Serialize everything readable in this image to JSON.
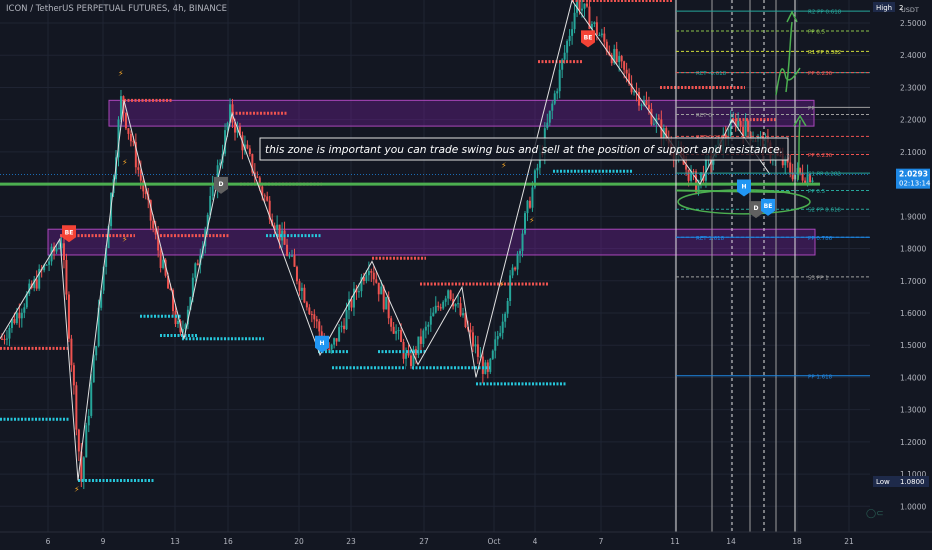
{
  "header": {
    "symbol_title": "ICON / TetherUS PERPETUAL FUTURES, 4h, BINANCE",
    "currency": "USDT"
  },
  "colors": {
    "background": "#131722",
    "grid": "#1f2433",
    "up_candle": "#26a69a",
    "down_candle": "#ef5350",
    "support_dots": "#26c6da",
    "resistance_dots": "#ef5350",
    "zone_fill": "#7b1fa2",
    "key_level": "#4caf50",
    "zigzag": "#e0e0e0",
    "price_tag": "#1e88e5",
    "annotation": "#ffffff"
  },
  "price_axis": {
    "ticks": [
      "2.5000",
      "2.4000",
      "2.3000",
      "2.2000",
      "2.1000",
      "2.0000",
      "1.9000",
      "1.8000",
      "1.7000",
      "1.6000",
      "1.5000",
      "1.4000",
      "1.3000",
      "1.2000",
      "1.1000",
      "1.0000"
    ],
    "current_price": "2.0293",
    "countdown": "02:13:14",
    "high_label": "High",
    "high_value": "2",
    "low_label": "Low",
    "low_value": "1.0800"
  },
  "time_axis": {
    "labels": [
      "6",
      "9",
      "13",
      "16",
      "20",
      "23",
      "27",
      "Oct",
      "4",
      "7",
      "11",
      "14",
      "18",
      "21"
    ]
  },
  "annotation_text": "this zone is important you can trade swing bus and sell at the position of support and resistance.",
  "pivot_labels": [
    {
      "text": "R2 PP 0.618",
      "price": 2.537,
      "color": "#26a69a"
    },
    {
      "text": "PP 0.5",
      "price": 2.475,
      "color": "#8bc34a"
    },
    {
      "text": "R1 PP 0.382",
      "price": 2.412,
      "color": "#cddc39"
    },
    {
      "text": "RET -0.618",
      "price": 2.346,
      "color": "#26a69a"
    },
    {
      "text": "PP 0.236",
      "price": 2.346,
      "color": "#ef5350"
    },
    {
      "text": "RET 0",
      "price": 2.216,
      "color": "#9e9e9e"
    },
    {
      "text": "PP",
      "price": 2.238,
      "color": "#9e9e9e"
    },
    {
      "text": "RET 0.236",
      "price": 2.148,
      "color": "#ef5350"
    },
    {
      "text": "PP 0.236",
      "price": 2.092,
      "color": "#ef5350"
    },
    {
      "text": "S1 PP 0.382",
      "price": 2.034,
      "color": "#26a69a"
    },
    {
      "text": "PP 0.5",
      "price": 1.98,
      "color": "#26a69a"
    },
    {
      "text": "S2 PP 0.618",
      "price": 1.922,
      "color": "#26a69a"
    },
    {
      "text": "RET 1.618",
      "price": 1.835,
      "color": "#1e88e5"
    },
    {
      "text": "PP 0.786",
      "price": 1.835,
      "color": "#1e88e5"
    },
    {
      "text": "S3 PP 1",
      "price": 1.712,
      "color": "#9e9e9e"
    },
    {
      "text": "PP 1.618",
      "price": 1.405,
      "color": "#1e88e5"
    }
  ],
  "markers": [
    {
      "text": "BE",
      "type": "sell",
      "x": 69,
      "price": 1.835
    },
    {
      "text": "BE",
      "type": "sell",
      "x": 588,
      "price": 2.44
    },
    {
      "text": "D",
      "type": "neutral",
      "x": 221,
      "price": 1.985
    },
    {
      "text": "H",
      "type": "buy",
      "x": 322,
      "price": 1.492
    },
    {
      "text": "H",
      "type": "buy",
      "x": 744,
      "price": 1.977
    },
    {
      "text": "D",
      "type": "neutral",
      "x": 756,
      "price": 1.91
    },
    {
      "text": "BE",
      "type": "buy",
      "x": 768,
      "price": 1.917
    }
  ],
  "chart_data": {
    "type": "candlestick",
    "title": "ICON / TetherUS PERPETUAL FUTURES, 4h, BINANCE",
    "xlabel": "",
    "ylabel": "",
    "x_labels": [
      "6",
      "9",
      "13",
      "16",
      "20",
      "23",
      "27",
      "Oct",
      "4",
      "7",
      "11",
      "14",
      "18",
      "21"
    ],
    "ylim": [
      0.96,
      2.58
    ],
    "grid": true,
    "last_price": 2.0293,
    "swing_points": [
      {
        "x_index": 0,
        "price": 1.52
      },
      {
        "x_index": 6,
        "price": 1.83
      },
      {
        "x_index": 8,
        "price": 1.08
      },
      {
        "x_index": 12,
        "price": 2.26
      },
      {
        "x_index": 18,
        "price": 1.52
      },
      {
        "x_index": 23,
        "price": 2.22
      },
      {
        "x_index": 33,
        "price": 1.47
      },
      {
        "x_index": 37,
        "price": 1.76
      },
      {
        "x_index": 41,
        "price": 1.44
      },
      {
        "x_index": 45,
        "price": 1.68
      },
      {
        "x_index": 49,
        "price": 1.4
      },
      {
        "x_index": 58,
        "price": 2.57
      },
      {
        "x_index": 70,
        "price": 2.0
      },
      {
        "x_index": 74,
        "price": 2.2
      },
      {
        "x_index": 80,
        "price": 2.03
      }
    ],
    "zones": [
      {
        "name": "resistance zone",
        "low": 2.18,
        "high": 2.26
      },
      {
        "name": "support zone",
        "low": 1.78,
        "high": 1.86
      }
    ],
    "key_level": 2.0,
    "resistance_levels": [
      2.26,
      2.22,
      2.0,
      1.84,
      1.77,
      1.69,
      2.3,
      2.2
    ],
    "support_levels": [
      1.27,
      1.08,
      1.59,
      1.53,
      1.84,
      1.52,
      1.42,
      1.48,
      1.43,
      1.38,
      2.04
    ]
  }
}
